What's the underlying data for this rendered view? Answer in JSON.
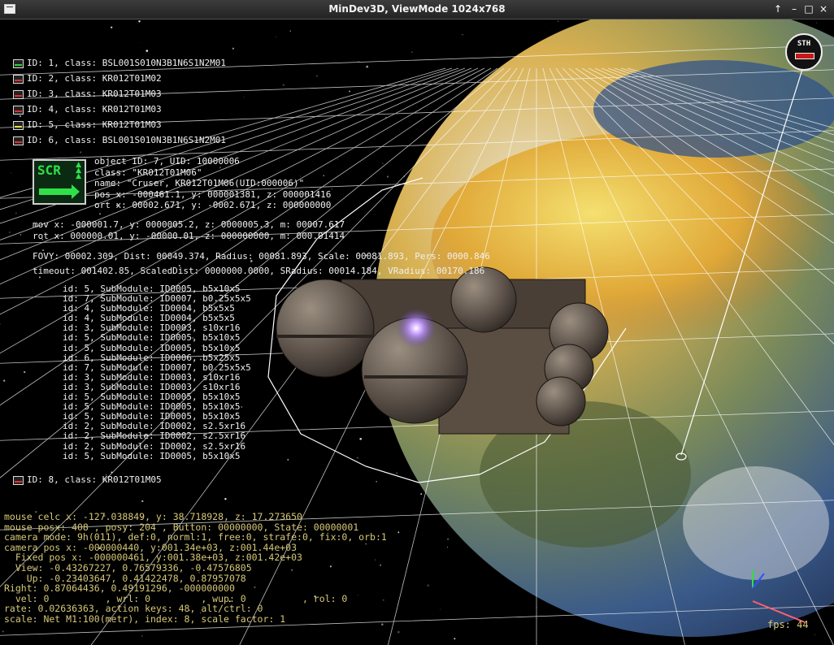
{
  "window": {
    "title": "MinDev3D, ViewMode 1024x768",
    "controls": [
      "↑",
      "–",
      "□",
      "×"
    ]
  },
  "colors": {
    "hud_text": "#f0f0f0",
    "debug_text": "#d6c878",
    "scr_green": "#2fe048",
    "grid": "#ffffff"
  },
  "objects": [
    {
      "icon": "ship-icon-green",
      "text": "ID: 1, class: BSL001S010N3B1N6S1N2M01"
    },
    {
      "icon": "ship-icon-red",
      "text": "ID: 2, class: KR012T01M02"
    },
    {
      "icon": "ship-icon-red",
      "text": "ID: 3, class: KR012T01M03"
    },
    {
      "icon": "ship-icon-red",
      "text": "ID: 4, class: KR012T01M03"
    },
    {
      "icon": "ship-icon-yellow",
      "text": "ID: 5, class: KR012T01M03"
    },
    {
      "icon": "ship-icon-red",
      "text": "ID: 6, class: BSL001S010N3B1N6S1N2M01"
    }
  ],
  "selected": {
    "badge": "SCR",
    "lines": [
      "object ID: 7, UID: 10000006",
      "class: \"KR012T01M06\"",
      "name: \"Cruser, KR012T01M06(UID:000006)\"",
      "pos x: -000461.1, y: 000001381, z: 000001416",
      "ort x: 00002.671, y: -0002.671, z: 000000000"
    ],
    "mov": "mov x: -000001.7, y: 0000005.2, z: 0000005.3, m: 00007.617",
    "rot": "rot x: 000000.01, y: -00000.01, z: 000000000, m: 000.01414",
    "fovy": "FOVY: 00002.309, Dist: 00049.374, Radius: 00081.893, Scale: 00081.893, Pers: 0000.846",
    "timeout": "timeout: 001402.85, ScaledDist: 0000000.0000, SRadius: 00014.184, VRadius: 00170.186"
  },
  "submodules": [
    "id: 5, SubModule: ID0005, b5x10x5",
    "id: 7, SubModule: ID0007, b0.25x5x5",
    "id: 4, SubModule: ID0004, b5x5x5",
    "id: 4, SubModule: ID0004, b5x5x5",
    "id: 3, SubModule: ID0003, s10xr16",
    "id: 5, SubModule: ID0005, b5x10x5",
    "id: 5, SubModule: ID0005, b5x10x5",
    "id: 6, SubModule: ID0006, b5x25x5",
    "id: 7, SubModule: ID0007, b0.25x5x5",
    "id: 3, SubModule: ID0003, s10xr16",
    "id: 3, SubModule: ID0003, s10xr16",
    "id: 5, SubModule: ID0005, b5x10x5",
    "id: 5, SubModule: ID0005, b5x10x5",
    "id: 5, SubModule: ID0005, b5x10x5",
    "id: 2, SubModule: ID0002, s2.5xr16",
    "id: 2, SubModule: ID0002, s2.5xr16",
    "id: 2, SubModule: ID0002, s2.5xr16",
    "id: 5, SubModule: ID0005, b5x10x5"
  ],
  "object8": {
    "icon": "ship-icon-red",
    "text": "ID: 8, class: KR012T01M05"
  },
  "stn_marker": {
    "label": "STH"
  },
  "debug": [
    "mouse celc x: -127.038849, y: 38.718928, z: 17.273650",
    "mouse posx: 408 , posy: 204 , Button: 00000000, State: 00000001",
    "camera mode: 9h(011), def:0, norml:1, free:0, strafe:0, fix:0, orb:1",
    "camera pos x: -000000440, y:001.34e+03, z:001.44e+03",
    "  Fixed pos x: -000000461, y:001.38e+03, z:001.42e+03",
    "  View: -0.43267227, 0.76579336, -0.47576805",
    "    Up: -0.23403647, 0.41422478, 0.87957078",
    "Right: 0.87064436, 0.49191296, -000000000",
    "  vel: 0          , wrl: 0         , wup: 0          , rol: 0",
    "rate: 0.02636363, action keys: 48, alt/ctrl: 0",
    "scale: Net M1:100(metr), index: 8, scale factor: 1"
  ],
  "fps": "fps: 44"
}
